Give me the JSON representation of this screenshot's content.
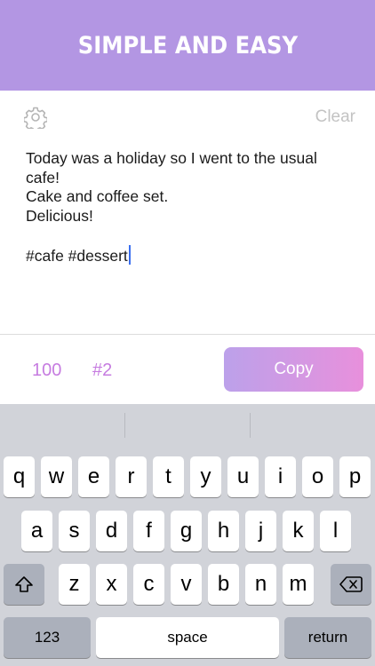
{
  "header": {
    "title": "SIMPLE AND EASY"
  },
  "toolbar": {
    "settings_icon": "gear-icon",
    "clear_label": "Clear"
  },
  "editor": {
    "lines": [
      "Today was a holiday so I went to the usual",
      "cafe!",
      "Cake and coffee set.",
      "Delicious!",
      "",
      "#cafe #dessert"
    ]
  },
  "stats": {
    "char_count": "100",
    "tag_count": "#2"
  },
  "actions": {
    "copy_label": "Copy"
  },
  "keyboard": {
    "row1": [
      "q",
      "w",
      "e",
      "r",
      "t",
      "y",
      "u",
      "i",
      "o",
      "p"
    ],
    "row2": [
      "a",
      "s",
      "d",
      "f",
      "g",
      "h",
      "j",
      "k",
      "l"
    ],
    "row3": [
      "z",
      "x",
      "c",
      "v",
      "b",
      "n",
      "m"
    ],
    "shift_icon": "shift-icon",
    "delete_icon": "backspace-icon",
    "numbers_label": "123",
    "space_label": "space",
    "return_label": "return"
  },
  "colors": {
    "banner": "#b396e3",
    "accent": "#c67ce0",
    "copy_gradient_start": "#bca1ea",
    "copy_gradient_end": "#e890dc",
    "caret": "#3a6ff0"
  }
}
